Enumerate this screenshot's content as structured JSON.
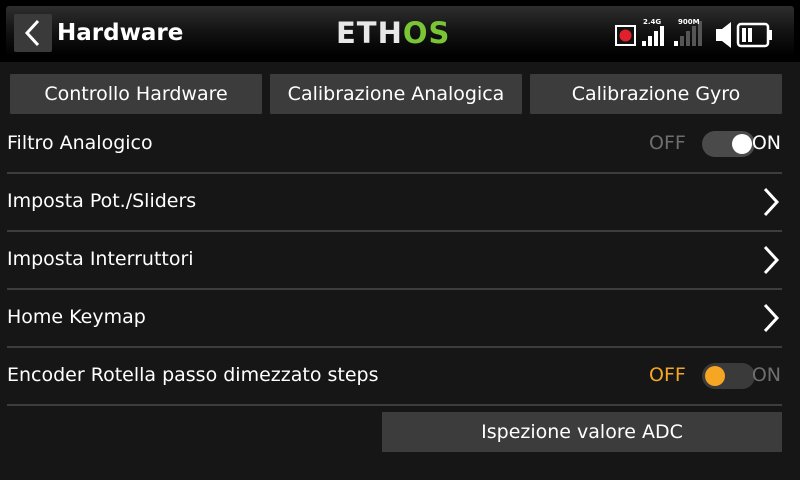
{
  "header": {
    "title": "Hardware",
    "logo_left": "ETH",
    "logo_right": "OS",
    "status": {
      "radio_24_label": "2.4G",
      "radio_900_label": "900M",
      "record_color": "#e0212d",
      "icons": [
        "record-icon",
        "signal-2g4-icon",
        "signal-900m-icon",
        "speaker-icon",
        "battery-icon"
      ]
    }
  },
  "tabs": [
    {
      "label": "Controllo Hardware"
    },
    {
      "label": "Calibrazione Analogica"
    },
    {
      "label": "Calibrazione Gyro"
    }
  ],
  "rows": {
    "filtro": {
      "label": "Filtro Analogico",
      "off": "OFF",
      "on": "ON",
      "state": "on"
    },
    "pots": {
      "label": "Imposta Pot./Sliders"
    },
    "switches": {
      "label": "Imposta Interruttori"
    },
    "keymap": {
      "label": "Home Keymap"
    },
    "encoder": {
      "label": "Encoder Rotella passo dimezzato steps",
      "off": "OFF",
      "on": "ON",
      "state": "off"
    }
  },
  "adc_button": {
    "label": "Ispezione valore ADC"
  },
  "colors": {
    "accent_green": "#7ac536",
    "toggle_off_accent": "#f5a623",
    "inactive_text": "#6e6e6e"
  }
}
